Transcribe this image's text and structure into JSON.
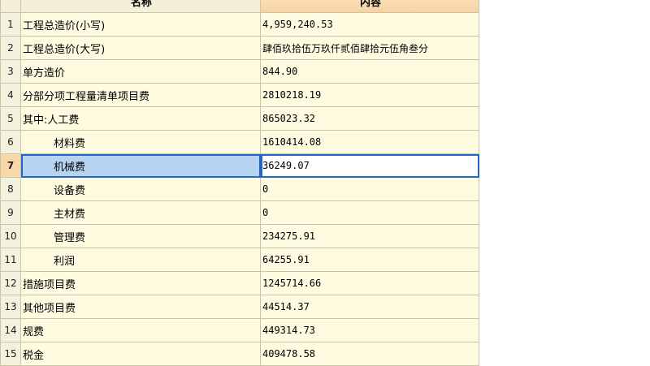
{
  "table": {
    "headers": {
      "name": "名称",
      "content": "内容"
    },
    "selected_row": 7,
    "rows": [
      {
        "num": "1",
        "name": "工程总造价(小写)",
        "value": "4,959,240.53",
        "indent": false
      },
      {
        "num": "2",
        "name": "工程总造价(大写)",
        "value": "肆佰玖拾伍万玖仟贰佰肆拾元伍角叁分",
        "indent": false
      },
      {
        "num": "3",
        "name": "单方造价",
        "value": "844.90",
        "indent": false
      },
      {
        "num": "4",
        "name": "分部分项工程量清单项目费",
        "value": "2810218.19",
        "indent": false
      },
      {
        "num": "5",
        "name": "其中:人工费",
        "value": "865023.32",
        "indent": false
      },
      {
        "num": "6",
        "name": "材料费",
        "value": "1610414.08",
        "indent": true
      },
      {
        "num": "7",
        "name": "机械费",
        "value": "36249.07",
        "indent": true
      },
      {
        "num": "8",
        "name": "设备费",
        "value": "0",
        "indent": true
      },
      {
        "num": "9",
        "name": "主材费",
        "value": "0",
        "indent": true
      },
      {
        "num": "10",
        "name": "管理费",
        "value": "234275.91",
        "indent": true
      },
      {
        "num": "11",
        "name": "利润",
        "value": "64255.91",
        "indent": true
      },
      {
        "num": "12",
        "name": "措施项目费",
        "value": "1245714.66",
        "indent": false
      },
      {
        "num": "13",
        "name": "其他项目费",
        "value": "44514.37",
        "indent": false
      },
      {
        "num": "14",
        "name": "规费",
        "value": "449314.73",
        "indent": false
      },
      {
        "num": "15",
        "name": "税金",
        "value": "409478.58",
        "indent": false
      }
    ]
  }
}
